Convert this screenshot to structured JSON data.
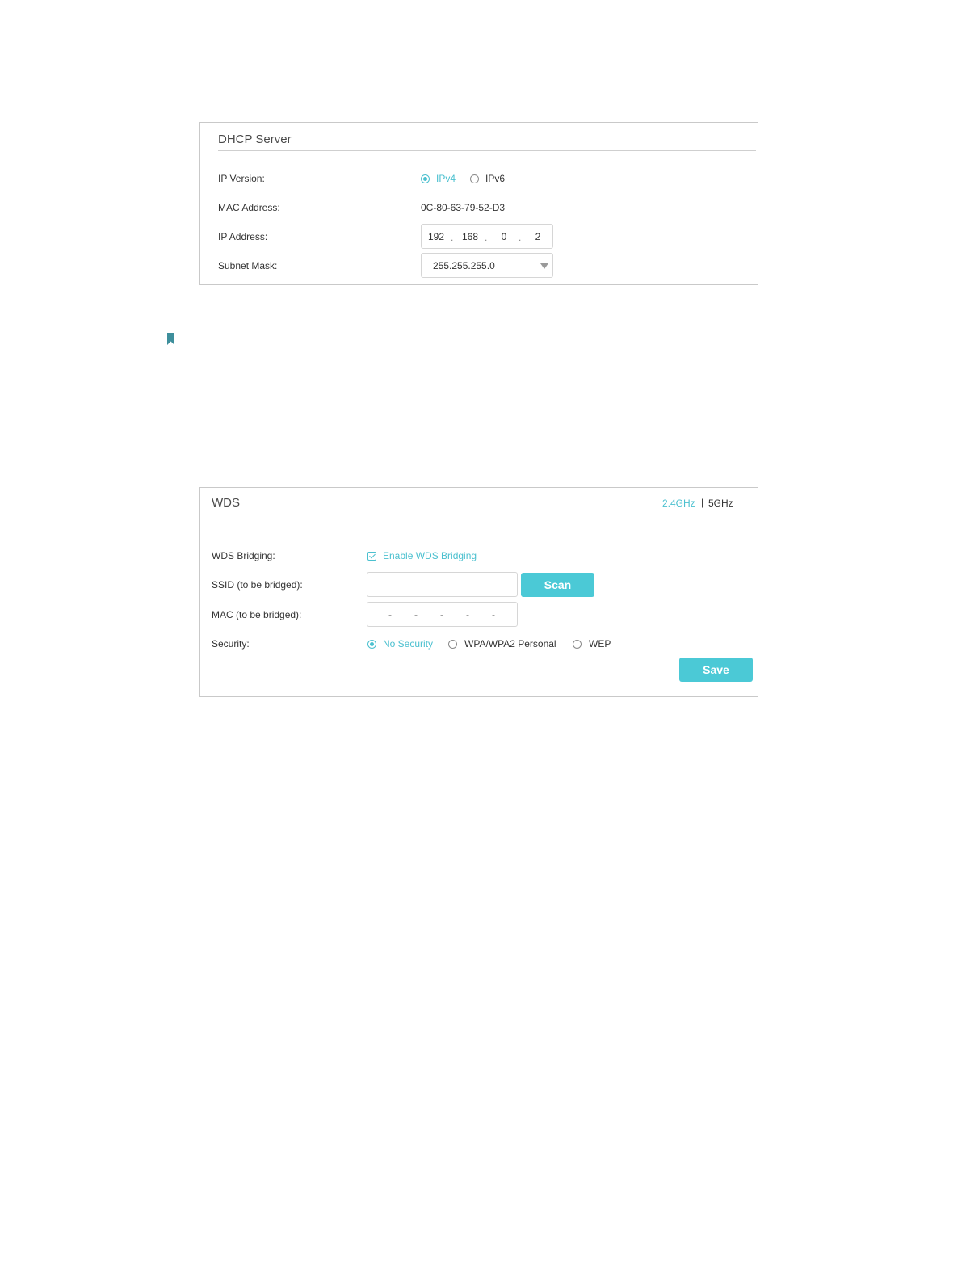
{
  "dhcp": {
    "title": "DHCP Server",
    "ip_version": {
      "label": "IP Version:",
      "options": [
        "IPv4",
        "IPv6"
      ],
      "selected": "IPv4"
    },
    "mac_address": {
      "label": "MAC Address:",
      "value": "0C-80-63-79-52-D3"
    },
    "ip_address": {
      "label": "IP Address:",
      "octets": [
        "192",
        "168",
        "0",
        "2"
      ],
      "separator": "."
    },
    "subnet_mask": {
      "label": "Subnet Mask:",
      "value": "255.255.255.0"
    }
  },
  "note_icon": "bookmark-icon",
  "wds": {
    "title": "WDS",
    "bands": [
      "2.4GHz",
      "5GHz"
    ],
    "band_separator": "|",
    "active_band": "2.4GHz",
    "bridging": {
      "label": "WDS Bridging:",
      "checkbox_label": "Enable WDS Bridging",
      "checked": true
    },
    "ssid": {
      "label": "SSID (to be bridged):",
      "value": "",
      "scan_label": "Scan"
    },
    "mac": {
      "label": "MAC (to be bridged):",
      "separators": [
        "-",
        "-",
        "-",
        "-",
        "-"
      ]
    },
    "security": {
      "label": "Security:",
      "options": [
        "No Security",
        "WPA/WPA2 Personal",
        "WEP"
      ],
      "selected": "No Security"
    },
    "save_label": "Save"
  },
  "colors": {
    "accent": "#4bc9d6",
    "border": "#c9c9c9",
    "text": "#333333"
  }
}
